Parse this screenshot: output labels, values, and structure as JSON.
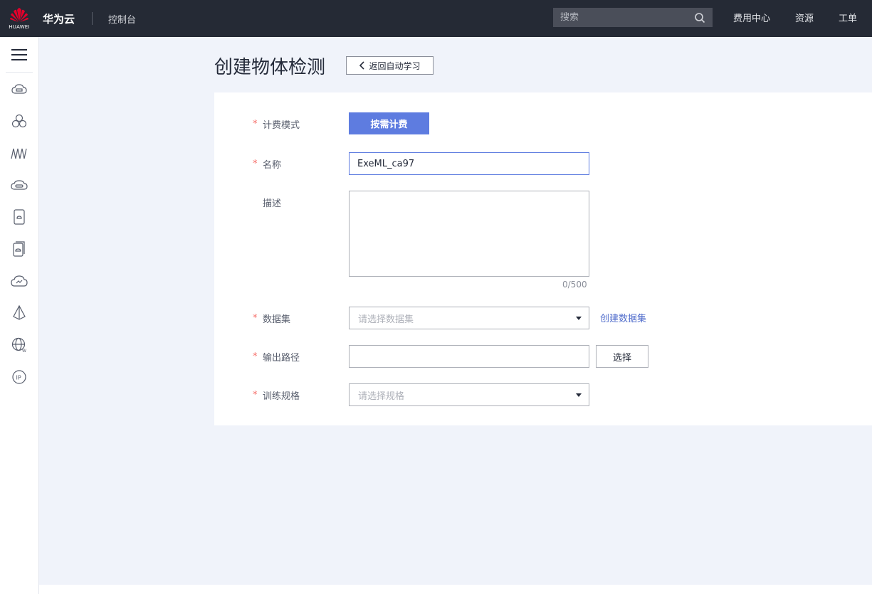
{
  "header": {
    "brand": "华为云",
    "logo_text": "HUAWEI",
    "console": "控制台",
    "search_placeholder": "搜索",
    "links": [
      "费用中心",
      "资源",
      "工单"
    ]
  },
  "sidebar": {
    "icons": [
      "menu-icon",
      "cloud-server-icon",
      "cluster-icon",
      "waveform-icon",
      "cloud-storage-icon",
      "disk-icon",
      "disk-backup-icon",
      "cloud-speed-icon",
      "pyramid-icon",
      "globe-icon",
      "ip-icon"
    ]
  },
  "page": {
    "title": "创建物体检测",
    "back_label": "返回自动学习"
  },
  "form": {
    "billing": {
      "label": "计费模式",
      "value": "按需计费",
      "required": true
    },
    "name": {
      "label": "名称",
      "value": "ExeML_ca97",
      "required": true
    },
    "description": {
      "label": "描述",
      "value": "",
      "counter": "0/500",
      "required": false
    },
    "dataset": {
      "label": "数据集",
      "placeholder": "请选择数据集",
      "create_link": "创建数据集",
      "required": true
    },
    "output_path": {
      "label": "输出路径",
      "value": "",
      "choose_label": "选择",
      "required": true
    },
    "spec": {
      "label": "训练规格",
      "placeholder": "请选择规格",
      "required": true
    },
    "required_mark": "*"
  },
  "colors": {
    "topbar": "#252a35",
    "primary": "#5e7ce0",
    "required": "#f66f6a",
    "link": "#526ecc",
    "page_bg": "#f0f3fa"
  }
}
